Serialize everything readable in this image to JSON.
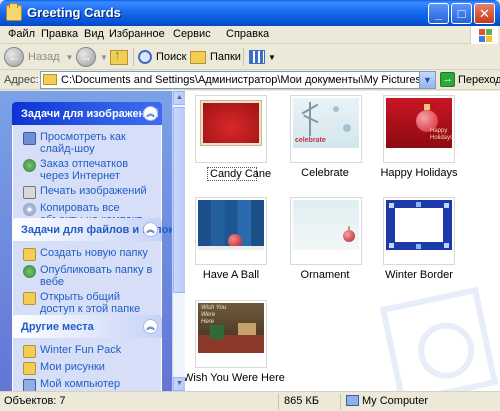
{
  "window": {
    "title": "Greeting Cards",
    "minimize": "_",
    "maximize": "□",
    "close": "✕"
  },
  "menu": [
    "Файл",
    "Правка",
    "Вид",
    "Избранное",
    "Сервис",
    "Справка"
  ],
  "toolbar": {
    "back_label": "Назад",
    "search_label": "Поиск",
    "folders_label": "Папки"
  },
  "address": {
    "label": "Адрес:",
    "path": "C:\\Documents and Settings\\Администратор\\Мои документы\\My Pictures\\Winter Fun Pack\\Greeting Cards",
    "go_label": "Переход"
  },
  "taskpane": {
    "groups": [
      {
        "title": "Задачи для изображений",
        "items": [
          {
            "label": "Просмотреть как слайд-шоу",
            "icon": "slideshow-icon"
          },
          {
            "label": "Заказ отпечатков через Интернет",
            "icon": "globe-icon"
          },
          {
            "label": "Печать изображений",
            "icon": "printer-icon"
          },
          {
            "label": "Копировать все объекты на компакт-диск",
            "icon": "cd-icon"
          }
        ]
      },
      {
        "title": "Задачи для файлов и папок",
        "items": [
          {
            "label": "Создать новую папку",
            "icon": "new-folder-icon"
          },
          {
            "label": "Опубликовать папку в вебе",
            "icon": "web-publish-icon"
          },
          {
            "label": "Открыть общий доступ к этой папке",
            "icon": "share-icon"
          }
        ]
      },
      {
        "title": "Другие места",
        "items": [
          {
            "label": "Winter Fun Pack",
            "icon": "folder-icon"
          },
          {
            "label": "Мои рисунки",
            "icon": "folder-icon"
          },
          {
            "label": "Мой компьютер",
            "icon": "computer-icon"
          }
        ]
      }
    ]
  },
  "files": [
    {
      "name": "Candy Cane",
      "selected": true
    },
    {
      "name": "Celebrate",
      "selected": false
    },
    {
      "name": "Happy Holidays",
      "selected": false
    },
    {
      "name": "Have A Ball",
      "selected": false
    },
    {
      "name": "Ornament",
      "selected": false
    },
    {
      "name": "Winter Border",
      "selected": false
    },
    {
      "name": "Wish You Were Here",
      "selected": false
    }
  ],
  "thumb_text": {
    "celebrate": "celebrate",
    "happy_holidays": "Happy Holidays",
    "wish": "Wish You Were Here"
  },
  "status": {
    "objects": "Объектов: 7",
    "size": "865 КБ",
    "location": "My Computer"
  },
  "colors": {
    "titlebar": "#0A5FE8",
    "taskpane_bg": "#7BA2E7",
    "link": "#215DC6",
    "go_green": "#2FA83B"
  }
}
